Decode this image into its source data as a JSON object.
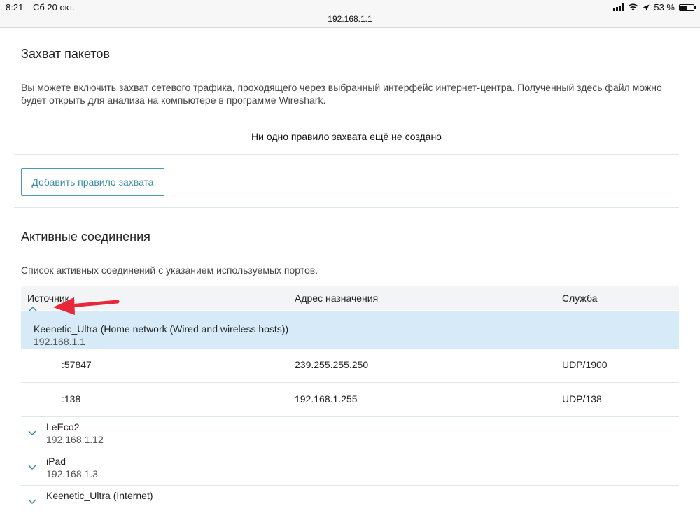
{
  "status_bar": {
    "time": "8:21",
    "date": "Сб 20 окт.",
    "url": "192.168.1.1",
    "battery": "53 %",
    "battery_level": 0.53,
    "icons": [
      "signal-icon",
      "wifi-icon",
      "location-icon",
      "battery-icon"
    ]
  },
  "capture": {
    "title": "Захват пакетов",
    "description": "Вы можете включить захват сетевого трафика, проходящего через выбранный интерфейс интернет-центра. Полученный здесь файл можно будет открыть для анализа на компьютере в программе Wireshark.",
    "empty_message": "Ни одно правило захвата ещё не создано",
    "add_button": "Добавить правило захвата"
  },
  "connections": {
    "title": "Активные соединения",
    "description": "Список активных соединений с указанием используемых портов.",
    "columns": {
      "source": "Источник",
      "destination": "Адрес назначения",
      "service": "Служба"
    },
    "groups": [
      {
        "name": "Keenetic_Ultra (Home network (Wired and wireless hosts))",
        "ip": "192.168.1.1",
        "expanded": true,
        "rows": [
          {
            "source": ":57847",
            "destination": "239.255.255.250",
            "service": "UDP/1900"
          },
          {
            "source": ":138",
            "destination": "192.168.1.255",
            "service": "UDP/138"
          }
        ]
      },
      {
        "name": "LeEco2",
        "ip": "192.168.1.12",
        "expanded": false
      },
      {
        "name": "iPad",
        "ip": "192.168.1.3",
        "expanded": false
      },
      {
        "name": "Keenetic_Ultra (Internet)",
        "ip": "",
        "expanded": false
      }
    ]
  },
  "colors": {
    "accent": "#3a8aa6",
    "selected_row": "#d7eaf7",
    "header_row": "#f2f4f5",
    "annotation_arrow": "#e8283a"
  }
}
